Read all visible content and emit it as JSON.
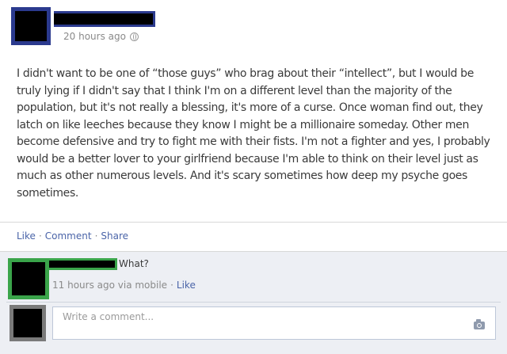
{
  "post": {
    "timestamp": "20 hours ago",
    "privacy_icon": "globe-icon",
    "body": "I didn't want to be one of “those guys” who brag about their “intellect”, but I would be truly lying if I didn't say that I think I'm on a different level than the majority of the population, but it's not really a blessing, it's more of a curse. Once woman find out, they latch on like leeches because they know I might be a millionaire someday. Other men become defensive and try to fight me with their fists. I'm not a fighter and yes, I probably would be a better lover to your girlfriend because I'm able to think on their level just as much as other numerous levels. And it's scary sometimes how deep my psyche goes sometimes."
  },
  "actions": {
    "like": "Like",
    "comment": "Comment",
    "share": "Share",
    "separator": "·"
  },
  "comment": {
    "text": "What?",
    "meta": "11 hours ago via mobile",
    "separator": "·",
    "like": "Like"
  },
  "composer": {
    "placeholder": "Write a comment...",
    "camera_icon": "camera-icon"
  },
  "colors": {
    "poster_highlight": "#2b3a8e",
    "commenter_highlight": "#3aa44a",
    "link": "#4a64a8",
    "comments_bg": "#edeff4"
  }
}
